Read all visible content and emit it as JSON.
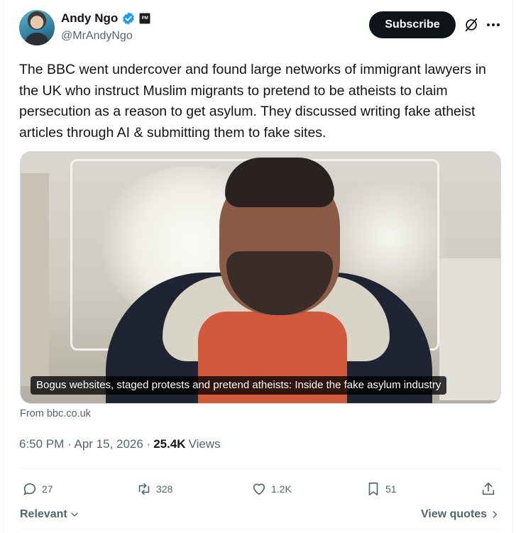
{
  "author": {
    "display_name": "Andy Ngo",
    "handle": "@MrAndyNgo",
    "verified": true,
    "affiliate_badge_text": "PM"
  },
  "header": {
    "subscribe_label": "Subscribe"
  },
  "tweet": {
    "text": "The BBC went undercover and found large networks of immigrant lawyers in the UK who instruct Muslim migrants to pretend to be atheists to claim persecution as a reason to get asylum. They discussed writing fake atheist articles through AI & submitting them to fake sites.",
    "media_caption": "Bogus websites, staged protests and pretend atheists: Inside the fake asylum industry",
    "source": "From bbc.co.uk",
    "timestamp": "6:50 PM · Apr 15, 2026 · ",
    "views_count": "25.4K",
    "views_label": "Views"
  },
  "actions": {
    "replies": "27",
    "reposts": "328",
    "likes": "1.2K",
    "bookmarks": "51"
  },
  "footer": {
    "sort_label": "Relevant",
    "view_quotes_label": "View quotes"
  },
  "colors": {
    "text_primary": "#0f1419",
    "text_secondary": "#536471",
    "verified_blue": "#1d9bf0",
    "button_dark": "#0f1419"
  }
}
